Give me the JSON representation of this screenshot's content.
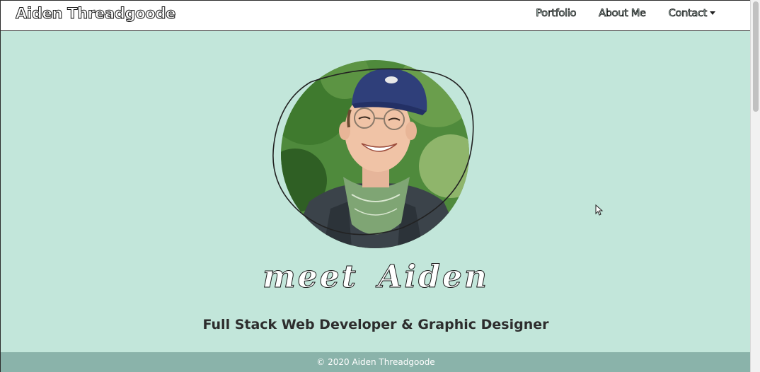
{
  "navbar": {
    "brand": "Aiden Threadgoode",
    "links": [
      {
        "label": "Portfolio"
      },
      {
        "label": "About Me"
      },
      {
        "label": "Contact",
        "has_dropdown": true
      }
    ]
  },
  "hero": {
    "script_title": "meet Aiden",
    "tagline": "Full Stack Web Developer & Graphic Designer"
  },
  "footer": {
    "copyright": "© 2020 Aiden Threadgoode"
  },
  "colors": {
    "hero_bg": "#c2e6da",
    "footer_bg": "#8ab3aa",
    "navbar_bg": "#ffffff"
  },
  "icons": {
    "dropdown": "caret-down-icon",
    "cursor": "mouse-pointer-icon"
  }
}
